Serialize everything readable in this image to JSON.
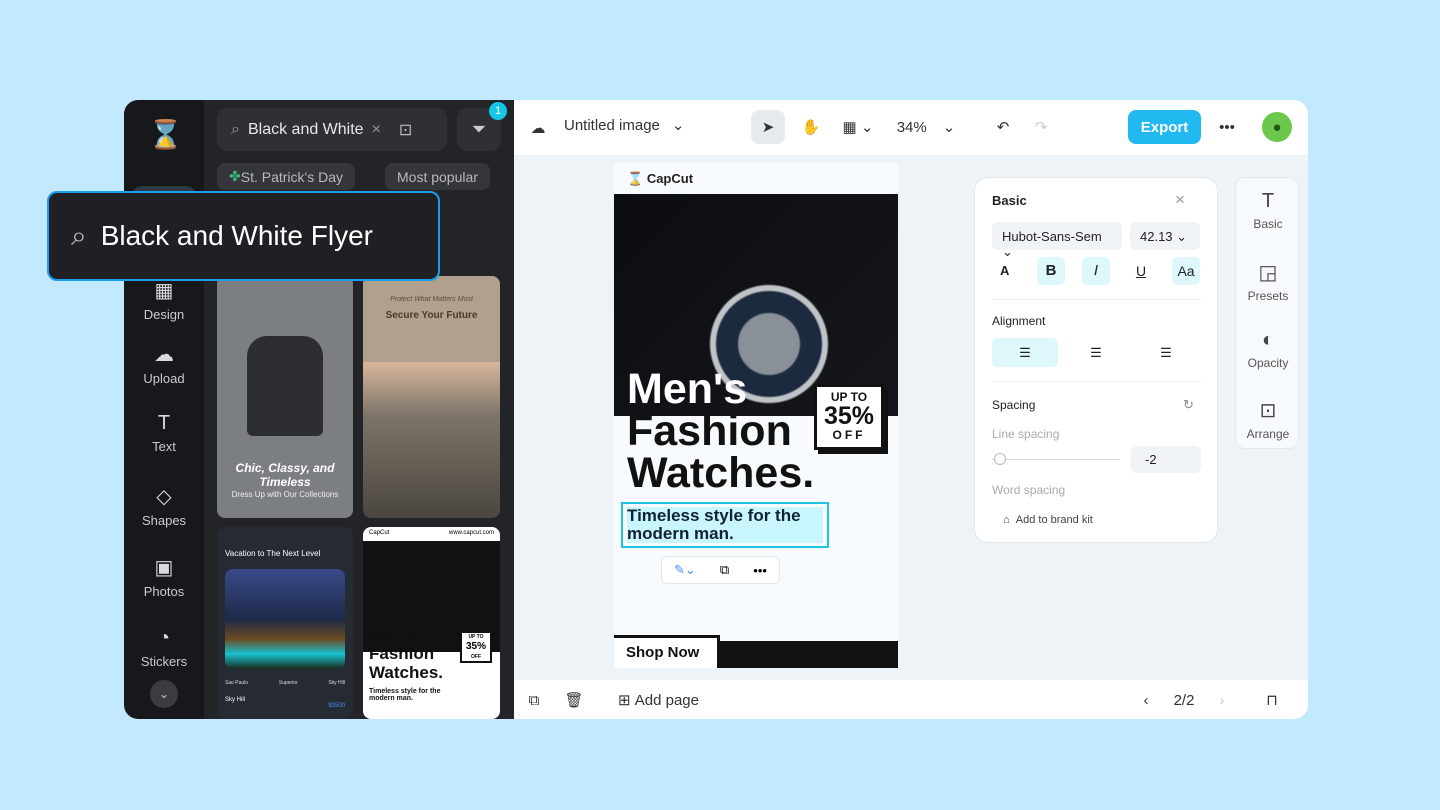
{
  "brand": {
    "accent": "#22b8f0",
    "logo": "capcut-logo"
  },
  "rail": {
    "items": [
      {
        "label": "Design",
        "icon": "design-icon"
      },
      {
        "label": "Upload",
        "icon": "upload-icon"
      },
      {
        "label": "Text",
        "icon": "text-icon"
      },
      {
        "label": "Shapes",
        "icon": "shapes-icon"
      },
      {
        "label": "Photos",
        "icon": "photos-icon"
      },
      {
        "label": "Stickers",
        "icon": "stickers-icon"
      }
    ]
  },
  "panel": {
    "search_value": "Black and White",
    "filter_badge": "1",
    "chips": [
      "St. Patrick's Day",
      "Most popular"
    ],
    "cards": [
      {
        "title": "Chic, Classy, and Timeless",
        "subtitle": "Dress Up with Our Collections"
      },
      {
        "kicker": "Protect What Matters Most",
        "title": "Secure Your Future"
      },
      {
        "title": "Vacation to The Next Level",
        "locations": [
          "Sao Paulo",
          "Superior",
          "Sky Hill"
        ],
        "name": "Sky Hill",
        "price": "$3500"
      },
      {
        "brand": "CapCut",
        "url": "www.capcut.com",
        "title": "Men's Fashion Watches.",
        "badge": [
          "UP TO",
          "35%",
          "OFF"
        ],
        "subtitle": "Timeless style for the modern man."
      }
    ]
  },
  "overlay": {
    "search_text": "Black and White Flyer"
  },
  "toolbar": {
    "title": "Untitled image",
    "zoom": "34%",
    "export": "Export"
  },
  "flyer": {
    "brand": "CapCut",
    "headline": [
      "Men's",
      "Fashion",
      "Watches."
    ],
    "badge_top": "UP TO",
    "badge_value": "35%",
    "badge_bottom": "OFF",
    "subtitle": "Timeless style for the modern man.",
    "cta": "Shop Now"
  },
  "props": {
    "title": "Basic",
    "font": "Hubot-Sans-Sem",
    "size": "42.13",
    "alignment": "Alignment",
    "spacing": "Spacing",
    "line_spacing": "Line spacing",
    "line_spacing_value": "-2",
    "word_spacing": "Word spacing",
    "brand_kit": "Add to brand kit"
  },
  "side": [
    {
      "label": "Basic",
      "icon": "T"
    },
    {
      "label": "Presets",
      "icon": "presets-icon"
    },
    {
      "label": "Opacity",
      "icon": "opacity-icon"
    },
    {
      "label": "Arrange",
      "icon": "arrange-icon"
    }
  ],
  "bottom": {
    "add_page": "Add page",
    "page": "2/2"
  }
}
